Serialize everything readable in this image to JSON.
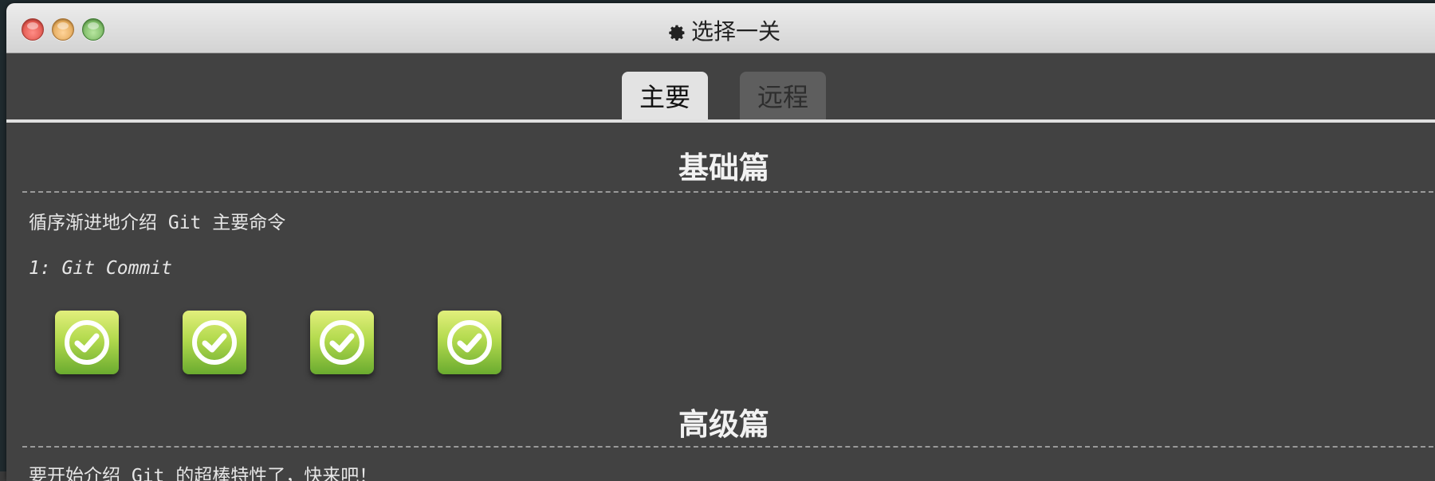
{
  "window": {
    "title": "选择一关",
    "title_icon": "gear-icon"
  },
  "tabs": [
    {
      "label": "主要",
      "active": true
    },
    {
      "label": "远程",
      "active": false
    }
  ],
  "sections": [
    {
      "title": "基础篇",
      "description": "循序渐进地介绍 Git 主要命令",
      "level_group": "1: Git Commit",
      "levels": [
        {
          "status": "completed",
          "icon": "checkmark-icon"
        },
        {
          "status": "completed",
          "icon": "checkmark-icon"
        },
        {
          "status": "completed",
          "icon": "checkmark-icon"
        },
        {
          "status": "completed",
          "icon": "checkmark-icon"
        }
      ]
    },
    {
      "title": "高级篇",
      "description": "要开始介绍 Git 的超棒特性了，快来吧！"
    }
  ],
  "colors": {
    "background": "#424242",
    "tab_active": "#e3e3e3",
    "tab_inactive": "#5e5e5e",
    "level_complete_top": "#e2ef7c",
    "level_complete_bottom": "#6aab2f"
  }
}
